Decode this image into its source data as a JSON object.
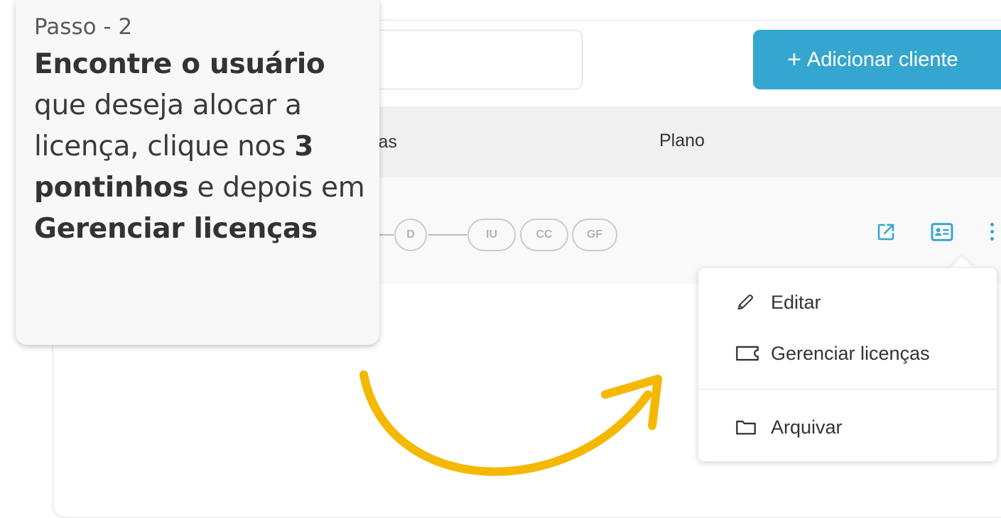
{
  "toolbar": {
    "search_placeholder": "",
    "add_client_icon": "+",
    "add_client_label": "Adicionar cliente"
  },
  "table": {
    "headers": {
      "licencas_partial": "ças",
      "plano": "Plano"
    },
    "row": {
      "chips": [
        "D",
        "IU",
        "CC",
        "GF"
      ],
      "icons": [
        "external-link-icon",
        "id-card-icon",
        "more-vertical-icon"
      ]
    }
  },
  "menu": {
    "items": [
      {
        "icon": "pencil-icon",
        "label": "Editar"
      },
      {
        "icon": "ticket-icon",
        "label": "Gerenciar licenças"
      },
      {
        "icon": "folder-icon",
        "label": "Arquivar"
      }
    ]
  },
  "callout": {
    "step": "Passo - 2",
    "line1_bold": "Encontre o usuário",
    "line1_rest": "que deseja alocar a licença, clique nos",
    "line2_bold": "3 pontinhos",
    "line2_rest": "e depois em",
    "line3_bold": "Gerenciar licenças"
  },
  "colors": {
    "accent": "#35a6cf",
    "arrow": "#f5b800",
    "header_bg": "#f0f0f0",
    "callout_bg": "#f8f8f8"
  }
}
